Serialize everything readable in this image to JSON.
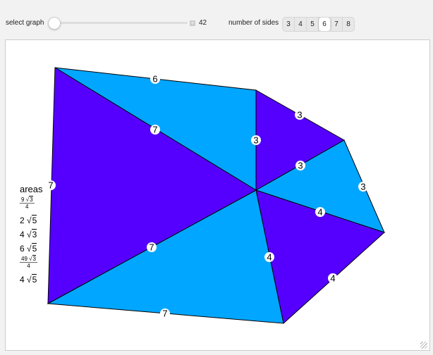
{
  "controls": {
    "select_graph_label": "select graph",
    "select_graph_value": "42",
    "sides_label": "number of sides",
    "sides_options": [
      "3",
      "4",
      "5",
      "6",
      "7",
      "8"
    ],
    "sides_selected": "6"
  },
  "colors": {
    "cyan": "#00a6ff",
    "purple": "#5500ff"
  },
  "areas": {
    "title": "areas",
    "items": [
      {
        "type": "frac",
        "num": "9",
        "rad": "3",
        "den": "4"
      },
      {
        "type": "coef",
        "coef": "2",
        "rad": "5"
      },
      {
        "type": "coef",
        "coef": "4",
        "rad": "3"
      },
      {
        "type": "coef",
        "coef": "6",
        "rad": "5"
      },
      {
        "type": "frac",
        "num": "49",
        "rad": "3",
        "den": "4"
      },
      {
        "type": "coef",
        "coef": "4",
        "rad": "5"
      }
    ]
  },
  "edge_labels": [
    "6",
    "3",
    "3",
    "4",
    "7",
    "7"
  ],
  "spoke_labels": [
    "3",
    "3",
    "4",
    "4",
    "7",
    "7"
  ]
}
